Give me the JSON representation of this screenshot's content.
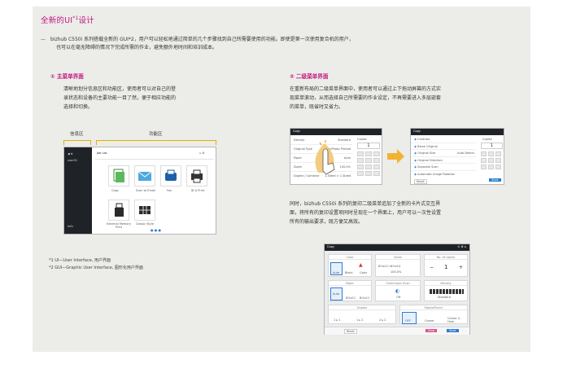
{
  "title": {
    "main": "全新的UI",
    "sup": "*1",
    "tail": "设计"
  },
  "intro": {
    "dash": "—",
    "line1": "bizhub C550i 系列搭载全新的 GUI*2，用户可以轻松地通过简单的几个步骤找到自己所需要使用的功能。即使是第一次使用复合机的用户，",
    "line2": "也可以在毫无障碍的情况下完成所需的作业，避免额外地时间和培训成本。"
  },
  "section1": {
    "heading": "① 主菜单界面",
    "text": [
      "清晰地划分信息区和功能区，使用者可以对自己的登",
      "录状态和设备的主要功能一目了然，便于相应功能的",
      "选择和切换。"
    ],
    "info_label": "信息区",
    "func_label": "功能区"
  },
  "main_screen": {
    "header": "Job List",
    "user": "user01",
    "info": "Info",
    "tiles": [
      {
        "label": "Copy",
        "icon": "copy-icon"
      },
      {
        "label": "Scan to Email",
        "icon": "email-icon"
      },
      {
        "label": "Fax",
        "icon": "fax-icon"
      },
      {
        "label": "ID & Print",
        "icon": "printer-icon"
      },
      {
        "label": "External Memory Print",
        "icon": "usb-icon"
      },
      {
        "label": "Classic Style",
        "icon": "grid-icon"
      }
    ]
  },
  "notes": [
    "*1  UI—User Interface, 用户界面",
    "*2  GUI—Graphic User Interface, 图形化用户界面"
  ],
  "section2": {
    "heading": "② 二级菜单界面",
    "text": [
      "在重新布局的二级菜单界面中，使用者可以通过上下拖动屏幕的方式实",
      "现菜单滚动，从而选择自己所需要的作业设定，不再需要进入多层嵌套",
      "的菜单，既省时又省力。"
    ],
    "text2": [
      "同时，bizhub C550i 系列的复印二级菜单追加了全新的卡片式交互界",
      "面，将所有的复印设置项同时呈现在一个界面上，用户可以一次性设置",
      "所有的输出要求，既方便又高效。"
    ]
  },
  "scroll_screen_left": {
    "title": "Copy",
    "copies_label": "Copies",
    "copies": "1",
    "rows": [
      "Density",
      "Original Type",
      "Paper",
      "Zoom",
      "Duplex / Combine"
    ],
    "values": [
      "Standard",
      "Text/Photo Printed",
      "Auto",
      "100.0%",
      "1-Sided > 1-Sided"
    ]
  },
  "scroll_screen_right": {
    "title": "Copy",
    "copies_label": "Copies",
    "copies": "1",
    "rows": [
      "Contrast",
      "Blank Original",
      "Original Size",
      "Original Direction",
      "Separate Scan",
      "Automatic Image Rotation"
    ],
    "values": [
      "",
      "",
      "Auto Detect",
      "",
      "",
      ""
    ],
    "reset": "Reset",
    "start": "Start"
  },
  "card_screen": {
    "title": "Copy",
    "cards": [
      {
        "head": "Color",
        "vals": [
          "Auto",
          "Black",
          "Color"
        ]
      },
      {
        "head": "Zoom",
        "vals": [
          "8½x11→8½x14",
          "100.0%"
        ]
      },
      {
        "head": "No. of copies",
        "vals": [
          "−",
          "1",
          "+"
        ]
      },
      {
        "head": "Paper",
        "vals": [
          "Auto",
          "8½x11",
          "8½x11"
        ]
      },
      {
        "head": "Continuous Scan",
        "vals": [
          "Off"
        ]
      },
      {
        "head": "Density",
        "vals": [
          "Standard"
        ]
      },
      {
        "head": "Duplex",
        "vals": [
          "1 ▸ 1",
          "1 ▸ 2",
          "2 ▸ 2"
        ]
      },
      {
        "head": "Staple/Punch",
        "vals": [
          "OFF",
          "Corner",
          "Corner 2-Hole"
        ]
      }
    ],
    "reset": "Reset",
    "stop": "Stop",
    "start": "Start"
  },
  "colors": {
    "accent": "#c0177f",
    "bracket": "#e3b000",
    "arrow": "#f2b233",
    "blue": "#2d7bd1"
  }
}
